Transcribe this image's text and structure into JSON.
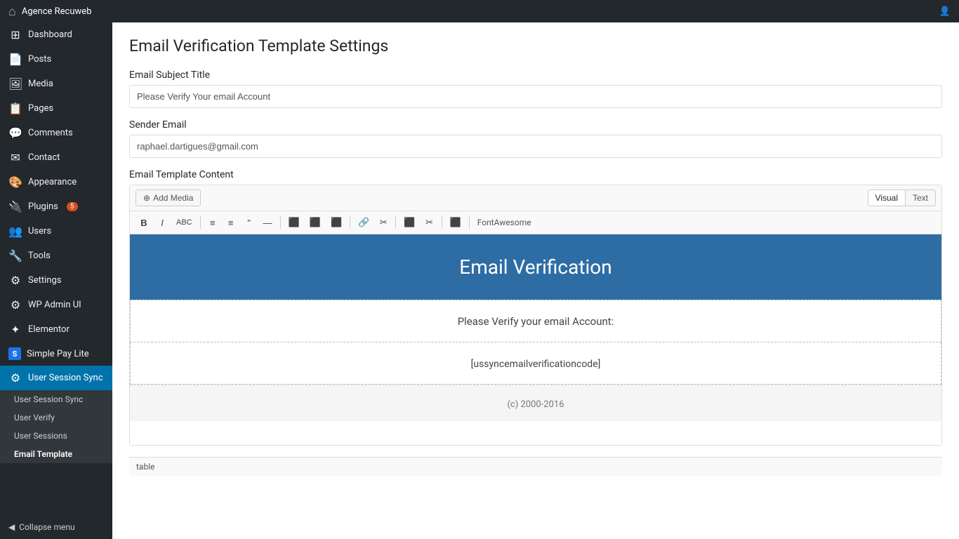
{
  "adminBar": {
    "siteName": "Agence Recuweb",
    "userIcon": "👤"
  },
  "sidebar": {
    "items": [
      {
        "id": "dashboard",
        "label": "Dashboard",
        "icon": "⊞"
      },
      {
        "id": "posts",
        "label": "Posts",
        "icon": "📄"
      },
      {
        "id": "media",
        "label": "Media",
        "icon": "🖼"
      },
      {
        "id": "pages",
        "label": "Pages",
        "icon": "📋"
      },
      {
        "id": "comments",
        "label": "Comments",
        "icon": "💬"
      },
      {
        "id": "contact",
        "label": "Contact",
        "icon": "✉"
      },
      {
        "id": "appearance",
        "label": "Appearance",
        "icon": "🎨"
      },
      {
        "id": "plugins",
        "label": "Plugins",
        "icon": "🔌",
        "badge": "5"
      },
      {
        "id": "users",
        "label": "Users",
        "icon": "👥"
      },
      {
        "id": "tools",
        "label": "Tools",
        "icon": "🔧"
      },
      {
        "id": "settings",
        "label": "Settings",
        "icon": "⚙"
      },
      {
        "id": "wpadminui",
        "label": "WP Admin UI",
        "icon": "⚙"
      },
      {
        "id": "elementor",
        "label": "Elementor",
        "icon": "✦"
      },
      {
        "id": "simplepaglite",
        "label": "Simple Pay Lite",
        "icon": "S"
      },
      {
        "id": "userSessionSync",
        "label": "User Session Sync",
        "icon": "⚙",
        "active": true
      }
    ],
    "submenu": [
      {
        "id": "userSessionSyncSub",
        "label": "User Session Sync"
      },
      {
        "id": "userVerify",
        "label": "User Verify"
      },
      {
        "id": "userSessions",
        "label": "User Sessions"
      },
      {
        "id": "emailTemplate",
        "label": "Email Template",
        "active": true
      }
    ],
    "collapseLabel": "Collapse menu"
  },
  "page": {
    "title": "Email Verification Template Settings",
    "emailSubjectSection": {
      "label": "Email Subject Title",
      "value": "Please Verify Your email Account"
    },
    "senderEmailSection": {
      "label": "Sender Email",
      "value": "raphael.dartigues@gmail.com"
    },
    "emailTemplateSection": {
      "label": "Email Template Content",
      "addMediaLabel": "Add Media",
      "visualLabel": "Visual",
      "textLabel": "Text",
      "formatButtons": [
        "B",
        "I",
        "ABC",
        "≡",
        "≡",
        "❝",
        "—",
        "⬛",
        "⬛",
        "⬛",
        "🔗",
        "✂",
        "⬛",
        "✂",
        "⬛"
      ],
      "fontAwesomeLabel": "FontAwesome"
    },
    "emailPreview": {
      "headerText": "Email Verification",
      "bodyText": "Please Verify your email Account:",
      "codeText": "[ussyncemailverificationcode]",
      "footerText": "(c) 2000-2016"
    },
    "bottomBar": "table"
  }
}
